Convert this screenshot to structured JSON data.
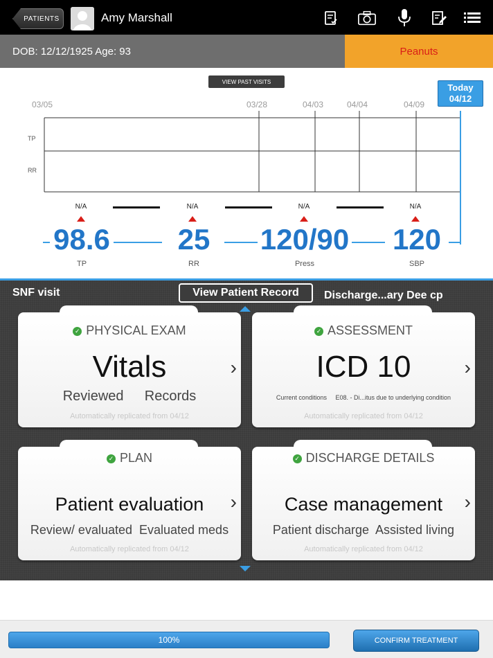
{
  "header": {
    "back_label": "PATIENTS",
    "patient_name": "Amy Marshall",
    "icons": [
      "notes-check-icon",
      "camera-icon",
      "microphone-icon",
      "edit-document-icon",
      "list-menu-icon"
    ]
  },
  "info": {
    "dob_text": "DOB: 12/12/1925  Age: 93",
    "allergy": "Peanuts"
  },
  "timeline": {
    "view_past_label": "VIEW PAST VISITS",
    "today_label": "Today",
    "today_date": "04/12",
    "dates": [
      "03/05",
      "03/28",
      "04/03",
      "04/04",
      "04/09"
    ],
    "rows": [
      "TP",
      "RR"
    ]
  },
  "vitals": [
    {
      "status": "N/A",
      "value": "98.6",
      "label": "TP"
    },
    {
      "status": "N/A",
      "value": "25",
      "label": "RR"
    },
    {
      "status": "N/A",
      "value": "120/90",
      "label": "Press"
    },
    {
      "status": "N/A",
      "value": "120",
      "label": "SBP"
    }
  ],
  "panel": {
    "visit_type": "SNF visit",
    "view_record_label": "View Patient Record",
    "discharge_label": "Discharge...ary Dee cp"
  },
  "cards": {
    "physical": {
      "title": "PHYSICAL EXAM",
      "main": "Vitals",
      "sub": "Reviewed    Records",
      "footer": "Automatically replicated from 04/12"
    },
    "assessment": {
      "title": "ASSESSMENT",
      "main": "ICD 10",
      "sub": "Current conditions     E08. - Di...itus due to underlying condition",
      "footer": "Automatically replicated from 04/12"
    },
    "plan": {
      "title": "PLAN",
      "main": "Patient evaluation",
      "sub": "Review/ evaluated  Evaluated meds",
      "footer": "Automatically replicated from 04/12"
    },
    "discharge": {
      "title": "DISCHARGE DETAILS",
      "main": "Case management",
      "sub": "Patient discharge  Assisted living",
      "footer": "Automatically replicated from 04/12"
    }
  },
  "footer": {
    "progress_label": "100%",
    "progress_value": 1.0,
    "confirm_label": "CONFIRM TREATMENT"
  },
  "colors": {
    "accent_blue": "#2276c8",
    "allergy_bg": "#f2a32a",
    "allergy_text": "#d91e18",
    "check_green": "#3fa43f"
  }
}
